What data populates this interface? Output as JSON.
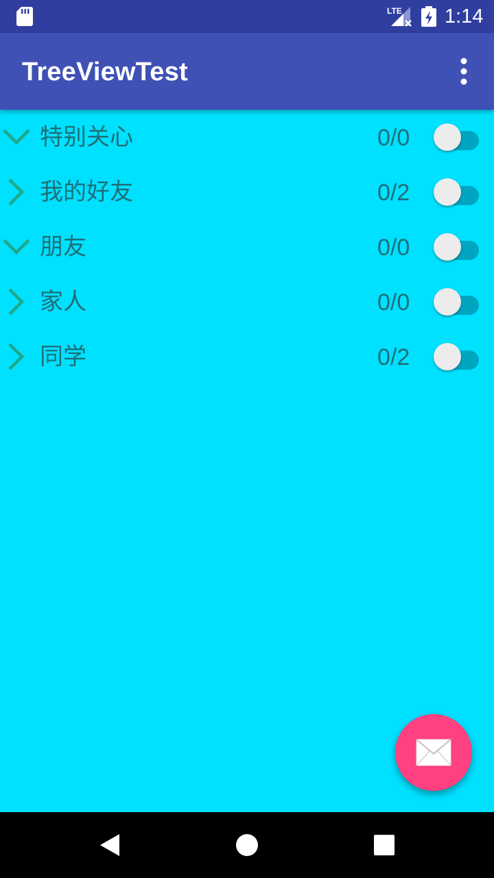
{
  "status_bar": {
    "time": "1:14",
    "network": "LTE",
    "icons": [
      "sd-card-icon",
      "signal-lte-icon",
      "battery-charging-icon"
    ]
  },
  "app_bar": {
    "title": "TreeViewTest",
    "menu_icon": "more-vert-icon"
  },
  "tree": {
    "groups": [
      {
        "name": "特别关心",
        "count": "0/0",
        "expanded": true,
        "switch_on": false
      },
      {
        "name": "我的好友",
        "count": "0/2",
        "expanded": false,
        "switch_on": false
      },
      {
        "name": "朋友",
        "count": "0/0",
        "expanded": true,
        "switch_on": false
      },
      {
        "name": "家人",
        "count": "0/0",
        "expanded": false,
        "switch_on": false
      },
      {
        "name": "同学",
        "count": "0/2",
        "expanded": false,
        "switch_on": false
      }
    ]
  },
  "fab": {
    "icon": "envelope-icon"
  },
  "nav_bar": {
    "icons": [
      "back-icon",
      "home-icon",
      "recents-icon"
    ]
  },
  "colors": {
    "status_bar": "#303F9F",
    "app_bar": "#3F51B5",
    "background": "#00E0FF",
    "text": "#1E6F78",
    "chevron": "#1FA88A",
    "switch_track": "#00A5C0",
    "switch_thumb": "#ECECEC",
    "fab": "#FF4081"
  }
}
